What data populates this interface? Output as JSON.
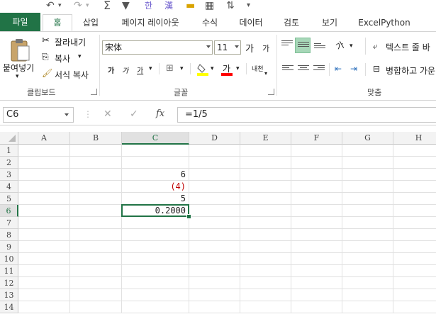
{
  "qat": {
    "undo_icon": "undo-icon",
    "redo_icon": "redo-icon",
    "sum_icon": "sum-icon",
    "filter_icon": "filter-icon"
  },
  "tabs": {
    "file": "파일",
    "home": "홈",
    "insert": "삽입",
    "page_layout": "페이지 레이아웃",
    "formulas": "수식",
    "data": "데이터",
    "review": "검토",
    "view": "보기",
    "excelpython": "ExcelPython"
  },
  "ribbon": {
    "clipboard": {
      "paste": "붙여넣기",
      "cut": "잘라내기",
      "copy": "복사",
      "format_painter": "서식 복사",
      "label": "클립보드"
    },
    "font": {
      "name": "宋体",
      "size": "11",
      "grow": "가",
      "shrink": "가",
      "bold": "가",
      "italic": "가",
      "underline": "가",
      "phonetic": "내천",
      "font_color_glyph": "가",
      "label": "글꼴"
    },
    "alignment": {
      "wrap_text": "텍스트 줄 바",
      "merge": "병합하고 가운",
      "orientation_glyph": "가",
      "label": "맞춤"
    }
  },
  "formula_bar": {
    "name_box": "C6",
    "cancel": "✕",
    "enter": "✓",
    "fx": "fx",
    "value": "=1/5"
  },
  "grid": {
    "columns": [
      "A",
      "B",
      "C",
      "D",
      "E",
      "F",
      "G",
      "H"
    ],
    "rows": [
      "1",
      "2",
      "3",
      "4",
      "5",
      "6",
      "7",
      "8",
      "9",
      "10",
      "11",
      "12",
      "13",
      "14"
    ],
    "cells": {
      "C3": "6",
      "C4": "(4)",
      "C5": "5",
      "C6": "0.2000"
    },
    "active_cell": "C6",
    "colors": {
      "accent": "#217346",
      "negative": "#c00000"
    }
  }
}
